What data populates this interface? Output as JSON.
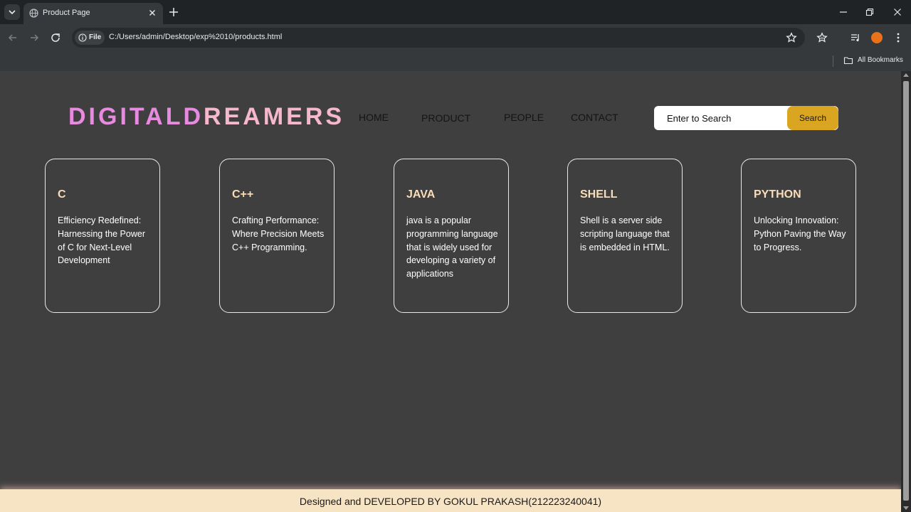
{
  "browser": {
    "tab_title": "Product Page",
    "address_chip": "File",
    "url": "C:/Users/admin/Desktop/exp%2010/products.html",
    "bookmarks_label": "All Bookmarks"
  },
  "logo": {
    "part1": "DIGITAL",
    "part2": "D",
    "part3": "R",
    "part4": "EAMERS",
    "colors": {
      "pink": "#e88ae0",
      "light_pink": "#f5b8cc"
    }
  },
  "nav": {
    "home": "HOME",
    "product": "PRODUCT",
    "people": "PEOPLE",
    "contact": "CONTACT"
  },
  "search": {
    "placeholder": "Enter to Search",
    "button": "Search",
    "button_color": "#daa520"
  },
  "cards": [
    {
      "title": "C",
      "text": "Efficiency Redefined: Harnessing the Power of C for Next-Level Development"
    },
    {
      "title": "C++",
      "text": "Crafting Performance: Where Precision Meets C++ Programming."
    },
    {
      "title": "JAVA",
      "text": "java is a popular programming language that is widely used for developing a variety of applications"
    },
    {
      "title": "SHELL",
      "text": "Shell is a server side scripting language that is embedded in HTML."
    },
    {
      "title": "PYTHON",
      "text": "Unlocking Innovation: Python Paving the Way to Progress."
    }
  ],
  "footer": {
    "text": "Designed and DEVELOPED BY GOKUL PRAKASH(212223240041)"
  }
}
